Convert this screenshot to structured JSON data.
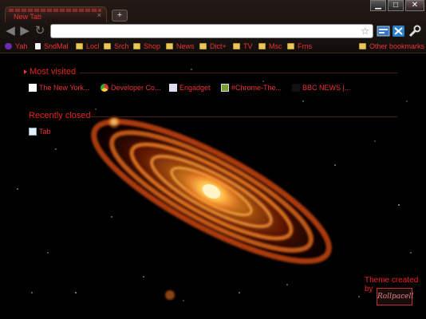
{
  "window": {
    "tab_title": "New Tab",
    "tab_close_glyph": "×",
    "new_tab_glyph": "+",
    "controls": {
      "minimize": "▁",
      "maximize": "□",
      "close": "✕"
    }
  },
  "toolbar": {
    "back_glyph": "◀",
    "forward_glyph": "▶",
    "reload_glyph": "↻",
    "url_value": "",
    "star_glyph": "☆",
    "icons": [
      "page-menu-icon",
      "extension-icon",
      "wrench-icon"
    ]
  },
  "bookmarks": {
    "items": [
      {
        "label": "Yah",
        "icon": "yahoo-icon"
      },
      {
        "label": "SndMal",
        "icon": "page-icon"
      },
      {
        "label": "Locl",
        "icon": "folder-icon"
      },
      {
        "label": "Srch",
        "icon": "folder-icon"
      },
      {
        "label": "Shop",
        "icon": "folder-icon"
      },
      {
        "label": "News",
        "icon": "folder-icon"
      },
      {
        "label": "Dict+",
        "icon": "folder-icon"
      },
      {
        "label": "TV",
        "icon": "folder-icon"
      },
      {
        "label": "Msc",
        "icon": "folder-icon"
      },
      {
        "label": "Frns",
        "icon": "folder-icon"
      }
    ],
    "other": "Other bookmarks"
  },
  "most_visited": {
    "title": "Most visited",
    "tiles": [
      {
        "label": "The New York...",
        "icon": "nyt-icon"
      },
      {
        "label": "Developer Co...",
        "icon": "chrome-icon"
      },
      {
        "label": "Engadget",
        "icon": "feed-icon"
      },
      {
        "label": "#Chrome-The...",
        "icon": "green-image-icon"
      },
      {
        "label": "BBC NEWS |...",
        "icon": "bbc-icon"
      }
    ]
  },
  "recently_closed": {
    "title": "Recently closed",
    "items": [
      {
        "label": "Tab",
        "icon": "page-icon"
      }
    ]
  },
  "theme_credit": {
    "text": "Theme created by",
    "logo_text": "Rollpacell"
  },
  "colors": {
    "accent": "#e2261c",
    "frame": "#1a1210",
    "folder": "#e8c65a",
    "galaxy_core": "#ffe6a0"
  }
}
